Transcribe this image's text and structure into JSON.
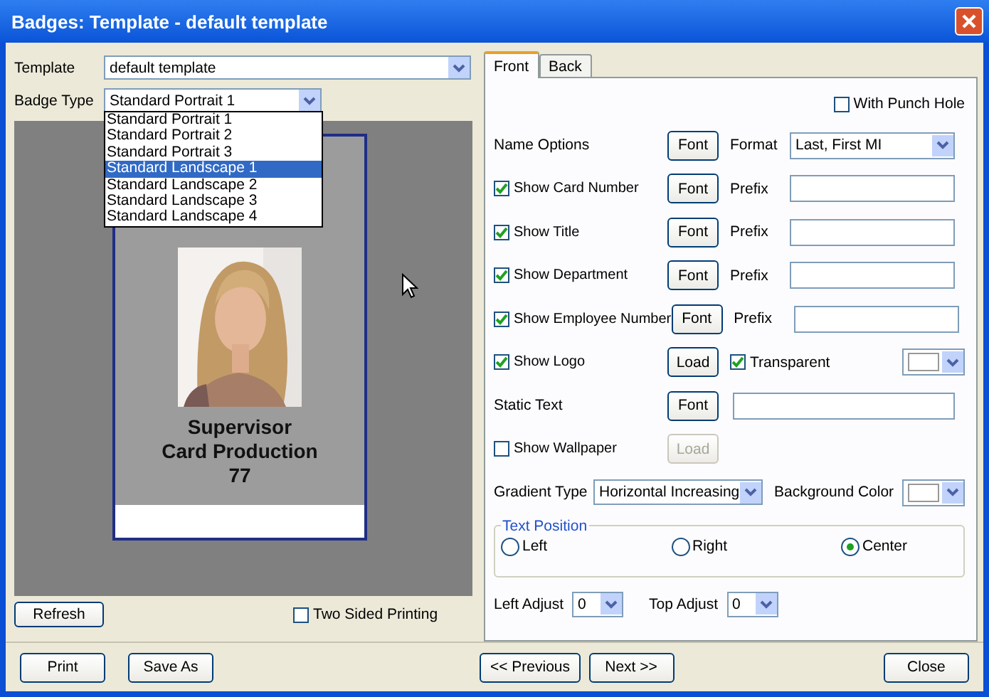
{
  "window": {
    "title": "Badges: Template - default template"
  },
  "template": {
    "label": "Template",
    "value": "default template"
  },
  "badge_type": {
    "label": "Badge Type",
    "value": "Standard Portrait 1",
    "expanded": true,
    "options": [
      {
        "label": "Standard Portrait 1",
        "highlighted": false
      },
      {
        "label": "Standard Portrait 2",
        "highlighted": false
      },
      {
        "label": "Standard Portrait 3",
        "highlighted": false
      },
      {
        "label": "Standard Landscape 1",
        "highlighted": true
      },
      {
        "label": "Standard Landscape 2",
        "highlighted": false
      },
      {
        "label": "Standard Landscape 3",
        "highlighted": false
      },
      {
        "label": "Standard Landscape 4",
        "highlighted": false
      }
    ]
  },
  "badge": {
    "lines": [
      "Supervisor",
      "Card Production",
      "77"
    ]
  },
  "refresh": "Refresh",
  "two_sided": {
    "label": "Two Sided Printing",
    "checked": false
  },
  "tabs": [
    {
      "label": "Front",
      "selected": true
    },
    {
      "label": "Back",
      "selected": false
    }
  ],
  "punch_hole": {
    "label": "With Punch Hole",
    "checked": false
  },
  "rows": [
    {
      "kind": "name",
      "label": "Name Options",
      "button": "Font",
      "format_label": "Format",
      "format": "Last, First MI"
    },
    {
      "kind": "prefix",
      "label": "Show Card Number",
      "checked": true,
      "button": "Font",
      "prefix_label": "Prefix"
    },
    {
      "kind": "prefix",
      "label": "Show Title",
      "checked": true,
      "button": "Font",
      "prefix_label": "Prefix"
    },
    {
      "kind": "prefix",
      "label": "Show Department",
      "checked": true,
      "button": "Font",
      "prefix_label": "Prefix"
    },
    {
      "kind": "prefix",
      "label": "Show Employee Number",
      "checked": true,
      "button": "Font",
      "prefix_label": "Prefix"
    },
    {
      "kind": "logo",
      "label": "Show Logo",
      "checked": true,
      "button": "Load",
      "transparent": {
        "label": "Transparent",
        "checked": true
      }
    },
    {
      "kind": "text",
      "label": "Static Text",
      "button": "Font"
    },
    {
      "kind": "wallpaper",
      "label": "Show Wallpaper",
      "checked": false,
      "button": "Load",
      "disabled": true
    }
  ],
  "gradient": {
    "label": "Gradient Type",
    "value": "Horizontal Increasing",
    "bg_label": "Background Color"
  },
  "text_position": {
    "legend": "Text Position",
    "options": [
      {
        "label": "Left",
        "selected": false
      },
      {
        "label": "Right",
        "selected": false
      },
      {
        "label": "Center",
        "selected": true
      }
    ]
  },
  "adjust": [
    {
      "label": "Left Adjust",
      "value": "0"
    },
    {
      "label": "Top Adjust",
      "value": "0"
    }
  ],
  "footer": {
    "left": [
      "Print",
      "Save As"
    ],
    "center": [
      "<< Previous",
      "Next >>"
    ],
    "right": [
      "Close"
    ]
  }
}
